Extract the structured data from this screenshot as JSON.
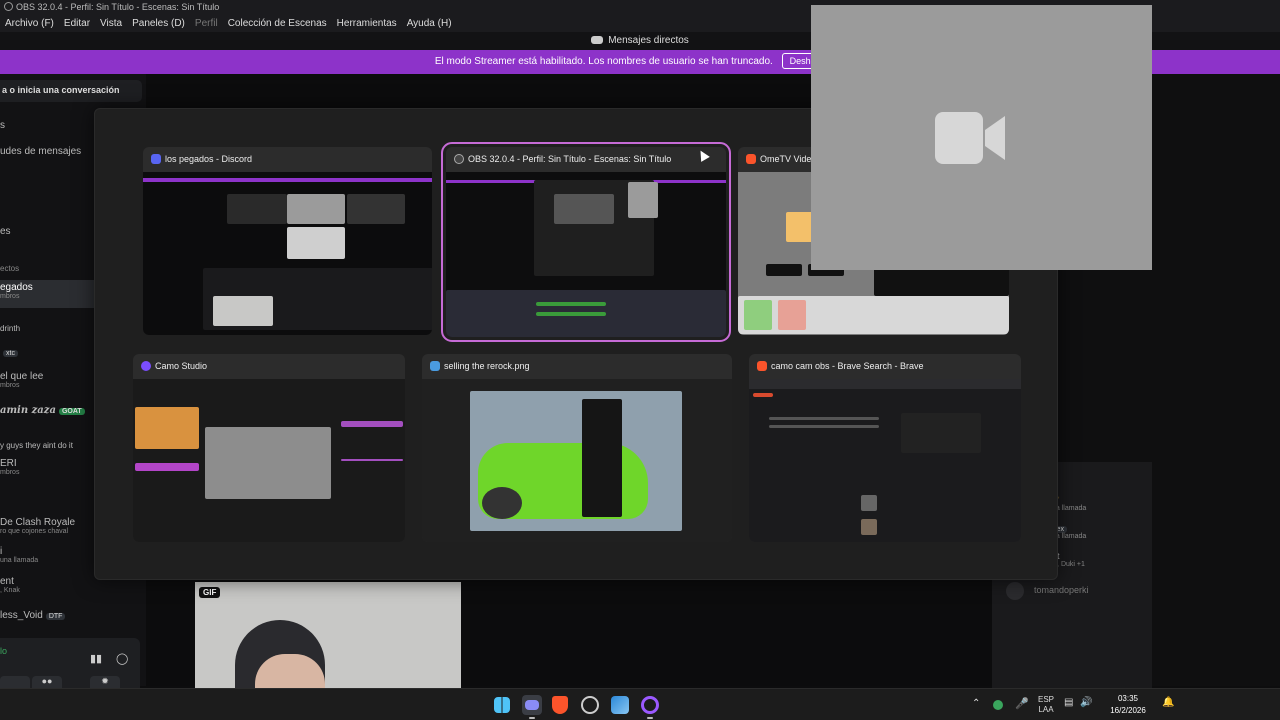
{
  "obs": {
    "title": "OBS 32.0.4 - Perfil: Sin Título - Escenas: Sin Título",
    "menu": [
      "Archivo (F)",
      "Editar",
      "Vista",
      "Paneles (D)",
      "Perfil",
      "Colección de Escenas",
      "Herramientas",
      "Ayuda (H)"
    ]
  },
  "discord": {
    "header_title": "Mensajes directos",
    "streamer_notice": "El modo Streamer está habilitado. Los nombres de usuario se han truncado.",
    "disable_button": "Deshabilitar",
    "search_placeholder": "a o inicia una conversación",
    "sidebar": {
      "nav1": "s",
      "nav2": "udes de mensajes",
      "nav3": "",
      "nav4": "es",
      "section": "ectos",
      "dms": [
        {
          "name": "egados",
          "sub": "mbros"
        },
        {
          "name": "drinth",
          "sub": ""
        },
        {
          "name": "",
          "badge": "xtc",
          "sub": ""
        },
        {
          "name": "el que lee",
          "sub": "mbros"
        },
        {
          "name": "amin zaza",
          "badge": "GOAT",
          "sub": ""
        },
        {
          "name": "y guys they aint do it",
          "sub": ""
        },
        {
          "name": "ERI",
          "sub": "mbros"
        },
        {
          "name": "De Clash Royale",
          "sub": "ro que cojones chaval"
        },
        {
          "name": "i",
          "sub": "una llamada"
        },
        {
          "name": "ent",
          "sub": ", Knak"
        },
        {
          "name": "less_Void",
          "badge": "DTF",
          "sub": ""
        }
      ],
      "status": "lo"
    },
    "right_panel": [
      {
        "name": "",
        "sub": "na llamada"
      },
      {
        "name": "lex",
        "sub": "na llamada"
      },
      {
        "name": "ttt",
        "sub": "U, Duki +1"
      }
    ],
    "right_user": "tomandoperki",
    "gif_label": "GIF"
  },
  "switcher": {
    "windows": [
      {
        "title": "los pegados - Discord",
        "icon_color": "#5865f2"
      },
      {
        "title": "OBS 32.0.4 - Perfil: Sin Título - Escenas: Sin Título",
        "icon_color": "#444444"
      },
      {
        "title": "OmeTV Video",
        "icon_color": "#fb542b"
      },
      {
        "title": "Camo Studio",
        "icon_color": "#7b4dff"
      },
      {
        "title": "selling the rerock.png",
        "icon_color": "#4a9be0"
      },
      {
        "title": "camo cam obs - Brave Search - Brave",
        "icon_color": "#fb542b"
      }
    ]
  },
  "taskbar": {
    "lang": "ESP",
    "layout": "LAA",
    "time": "03:35",
    "date": "16/2/2026"
  }
}
